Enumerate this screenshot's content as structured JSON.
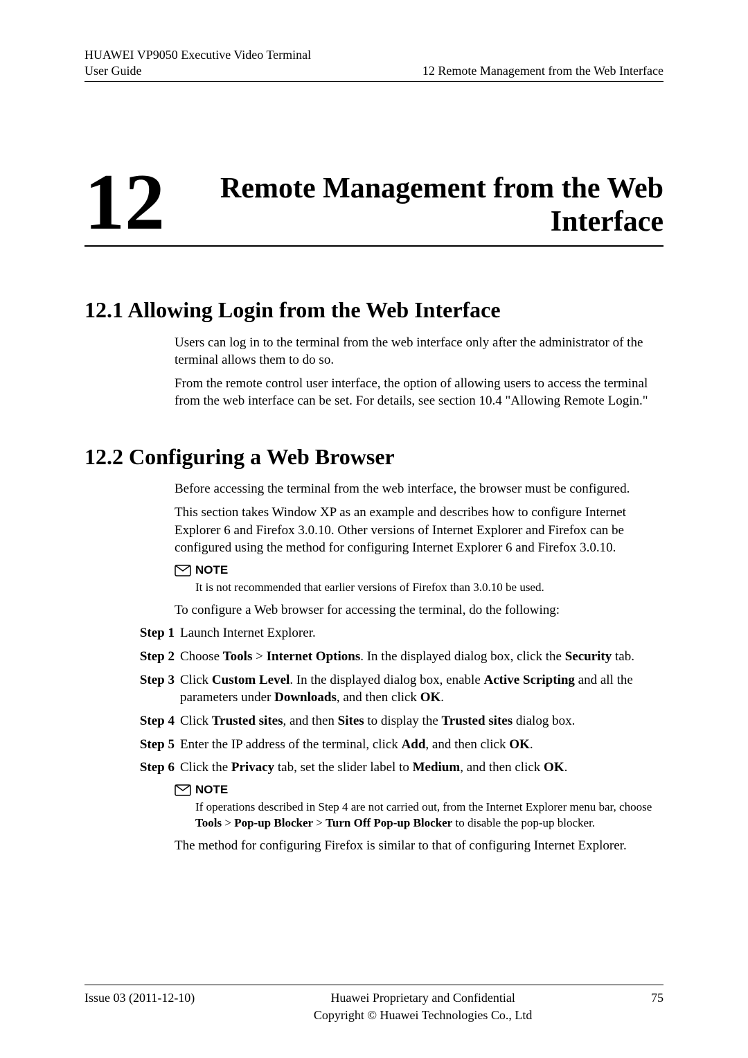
{
  "header": {
    "product": "HUAWEI VP9050 Executive Video Terminal",
    "guide": "User Guide",
    "chapter_ref": "12 Remote Management from the Web Interface"
  },
  "chapter": {
    "number": "12",
    "title": "Remote Management from the Web Interface"
  },
  "section_12_1": {
    "heading": "12.1 Allowing Login from the Web Interface",
    "p1": "Users can log in to the terminal from the web interface only after the administrator of the terminal allows them to do so.",
    "p2": "From the remote control user interface, the option of allowing users to access the terminal from the web interface can be set. For details, see section 10.4 \"Allowing Remote Login.\""
  },
  "section_12_2": {
    "heading": "12.2 Configuring a Web Browser",
    "p1": "Before accessing the terminal from the web interface, the browser must be configured.",
    "p2": "This section takes Window XP as an example and describes how to configure Internet Explorer 6 and Firefox 3.0.10. Other versions of Internet Explorer and Firefox can be configured using the method for configuring Internet Explorer 6 and Firefox 3.0.10.",
    "note1_label": "NOTE",
    "note1_text": "It is not recommended that earlier versions of Firefox than 3.0.10 be used.",
    "p3": "To configure a Web browser for accessing the terminal, do the following:",
    "steps": [
      {
        "label": "Step 1",
        "text_plain": "Launch Internet Explorer."
      },
      {
        "label": "Step 2",
        "parts": [
          "Choose ",
          "Tools",
          " > ",
          "Internet Options",
          ". In the displayed dialog box, click the ",
          "Security",
          " tab."
        ]
      },
      {
        "label": "Step 3",
        "parts": [
          "Click ",
          "Custom Level",
          ". In the displayed dialog box, enable ",
          "Active Scripting",
          " and all the parameters under ",
          "Downloads",
          ", and then click ",
          "OK",
          "."
        ]
      },
      {
        "label": "Step 4",
        "parts": [
          "Click ",
          "Trusted sites",
          ", and then ",
          "Sites",
          " to display the ",
          "Trusted sites",
          " dialog box."
        ]
      },
      {
        "label": "Step 5",
        "parts": [
          "Enter the IP address of the terminal, click ",
          "Add",
          ", and then click ",
          "OK",
          "."
        ]
      },
      {
        "label": "Step 6",
        "parts": [
          "Click the ",
          "Privacy",
          " tab, set the slider label to ",
          "Medium",
          ", and then click ",
          "OK",
          "."
        ]
      }
    ],
    "note2_label": "NOTE",
    "note2_parts": [
      "If operations described in Step 4 are not carried out, from the Internet Explorer menu bar, choose ",
      "Tools",
      " > ",
      "Pop-up Blocker",
      " > ",
      "Turn Off Pop-up Blocker",
      " to disable the pop-up blocker."
    ],
    "p4": "The method for configuring Firefox is similar to that of configuring Internet Explorer."
  },
  "footer": {
    "issue": "Issue 03 (2011-12-10)",
    "confidential": "Huawei Proprietary and Confidential",
    "copyright": "Copyright © Huawei Technologies Co., Ltd",
    "page": "75"
  }
}
